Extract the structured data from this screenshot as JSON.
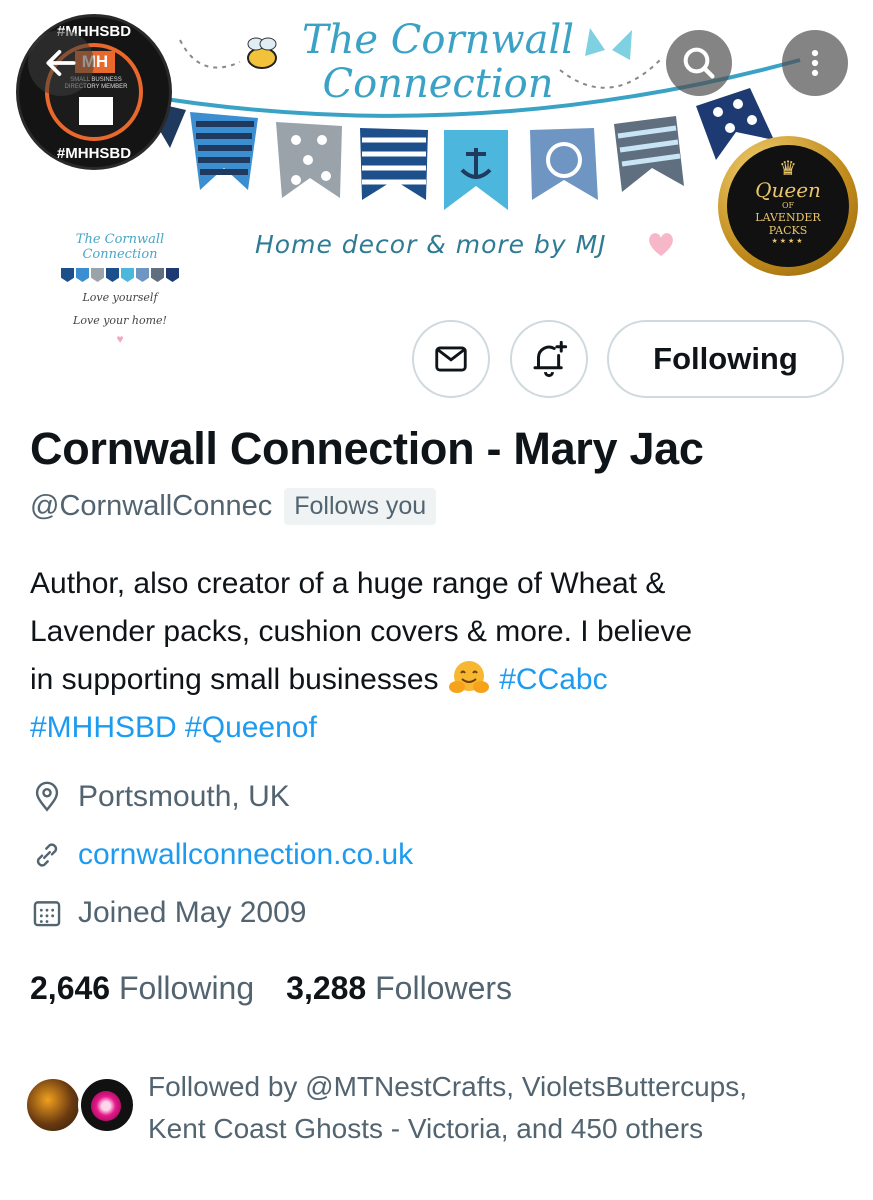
{
  "banner": {
    "title_line1": "The Cornwall",
    "title_line2": "Connection",
    "tagline": "Home decor & more by MJ",
    "mini_logo": {
      "title_line1": "The Cornwall",
      "title_line2": "Connection",
      "line1": "Love yourself",
      "line2": "Love your home!"
    },
    "mh_badge": {
      "top_text": "#MHHSBD",
      "bottom_text": "#MHHSBD",
      "logo": "MH",
      "sub": "SMALL BUSINESS DIRECTORY MEMBER"
    },
    "queen_badge": {
      "crown": "♛",
      "line1": "Queen",
      "line2": "OF",
      "line3a": "LAVENDER",
      "line3b": "PACKS",
      "stars": "★★★★"
    }
  },
  "toolbar": {
    "back_icon": "arrow-left-icon",
    "search_icon": "search-icon",
    "more_icon": "more-vertical-icon"
  },
  "actions": {
    "message_icon": "mail-icon",
    "notify_icon": "bell-plus-icon",
    "follow_label": "Following"
  },
  "profile": {
    "display_name": "Cornwall Connection - Mary Jac",
    "handle": "@CornwallConnec",
    "follows_you": "Follows you",
    "bio_line1": "Author, also creator of a huge range of Wheat &",
    "bio_line2": "Lavender packs, cushion covers & more. I believe",
    "bio_line3": "in supporting small businesses ",
    "bio_emoji": "hugging-face-emoji",
    "bio_tag1": "#CCabc",
    "bio_tag2": "#MHHSBD",
    "bio_tag3": "#Queenof",
    "location": "Portsmouth, UK",
    "url": "cornwallconnection.co.uk",
    "joined": "Joined May 2009"
  },
  "stats": {
    "following_count": "2,646",
    "following_label": "Following",
    "followers_count": "3,288",
    "followers_label": "Followers"
  },
  "followed_by": {
    "line1": "Followed by @MTNestCrafts, VioletsButtercups,",
    "line2": "Kent Coast Ghosts - Victoria, and 450 others"
  },
  "colors": {
    "accent": "#1d9bf0",
    "secondary_text": "#536471",
    "primary_text": "#0f1419",
    "border": "#cfd9de"
  }
}
